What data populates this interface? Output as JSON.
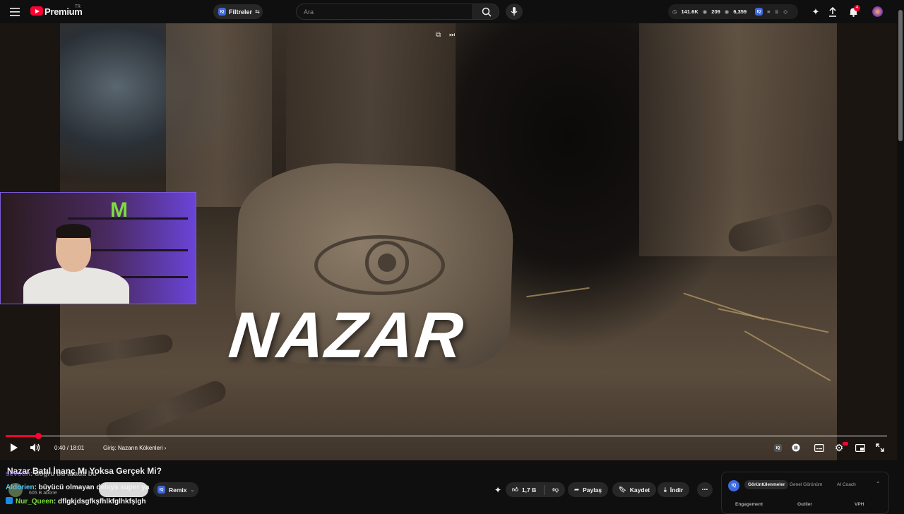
{
  "header": {
    "brand": "Premium",
    "brand_region": "TR",
    "filter_label": "Filtreler",
    "search_placeholder": "Ara",
    "stats": {
      "views": "141.6K",
      "comments": "209",
      "third": "6,359"
    },
    "notification_count": "4"
  },
  "video": {
    "thumbnail_text": "NAZAR",
    "time": "0:40 / 18:01",
    "chapter": "Giriş: Nazarın Kökenleri",
    "progress_fraction": 0.037
  },
  "below": {
    "title": "Nazar Batıl İnanç Mı Yoksa Gerçek Mi?",
    "channel_subs": "605 B abone",
    "remix_label": "Remix",
    "likes": "1,7 B",
    "share_label": "Paylaş",
    "save_label": "Kaydet",
    "download_label": "İndir"
  },
  "chat": [
    {
      "user": "sevoun",
      "message": ": doğru bu arada bu",
      "color": "#b388ff"
    },
    {
      "user": "Aldorien",
      "message": ": büyücü olmayan delays super ya",
      "color": "#4fc3f7"
    },
    {
      "user": "Nur_Queen",
      "message": ": dflgkjdsgfkşfhlkfglhkfşlgh",
      "color": "#7ddc3c"
    }
  ],
  "panel": {
    "tabs": [
      "Görüntülenmeler",
      "Genel Görünüm",
      "AI Coach"
    ],
    "columns": [
      "Engagement",
      "Outlier",
      "VPH"
    ]
  },
  "colors": {
    "accent": "#ff0033",
    "iq_blue": "#3e6ae1"
  }
}
